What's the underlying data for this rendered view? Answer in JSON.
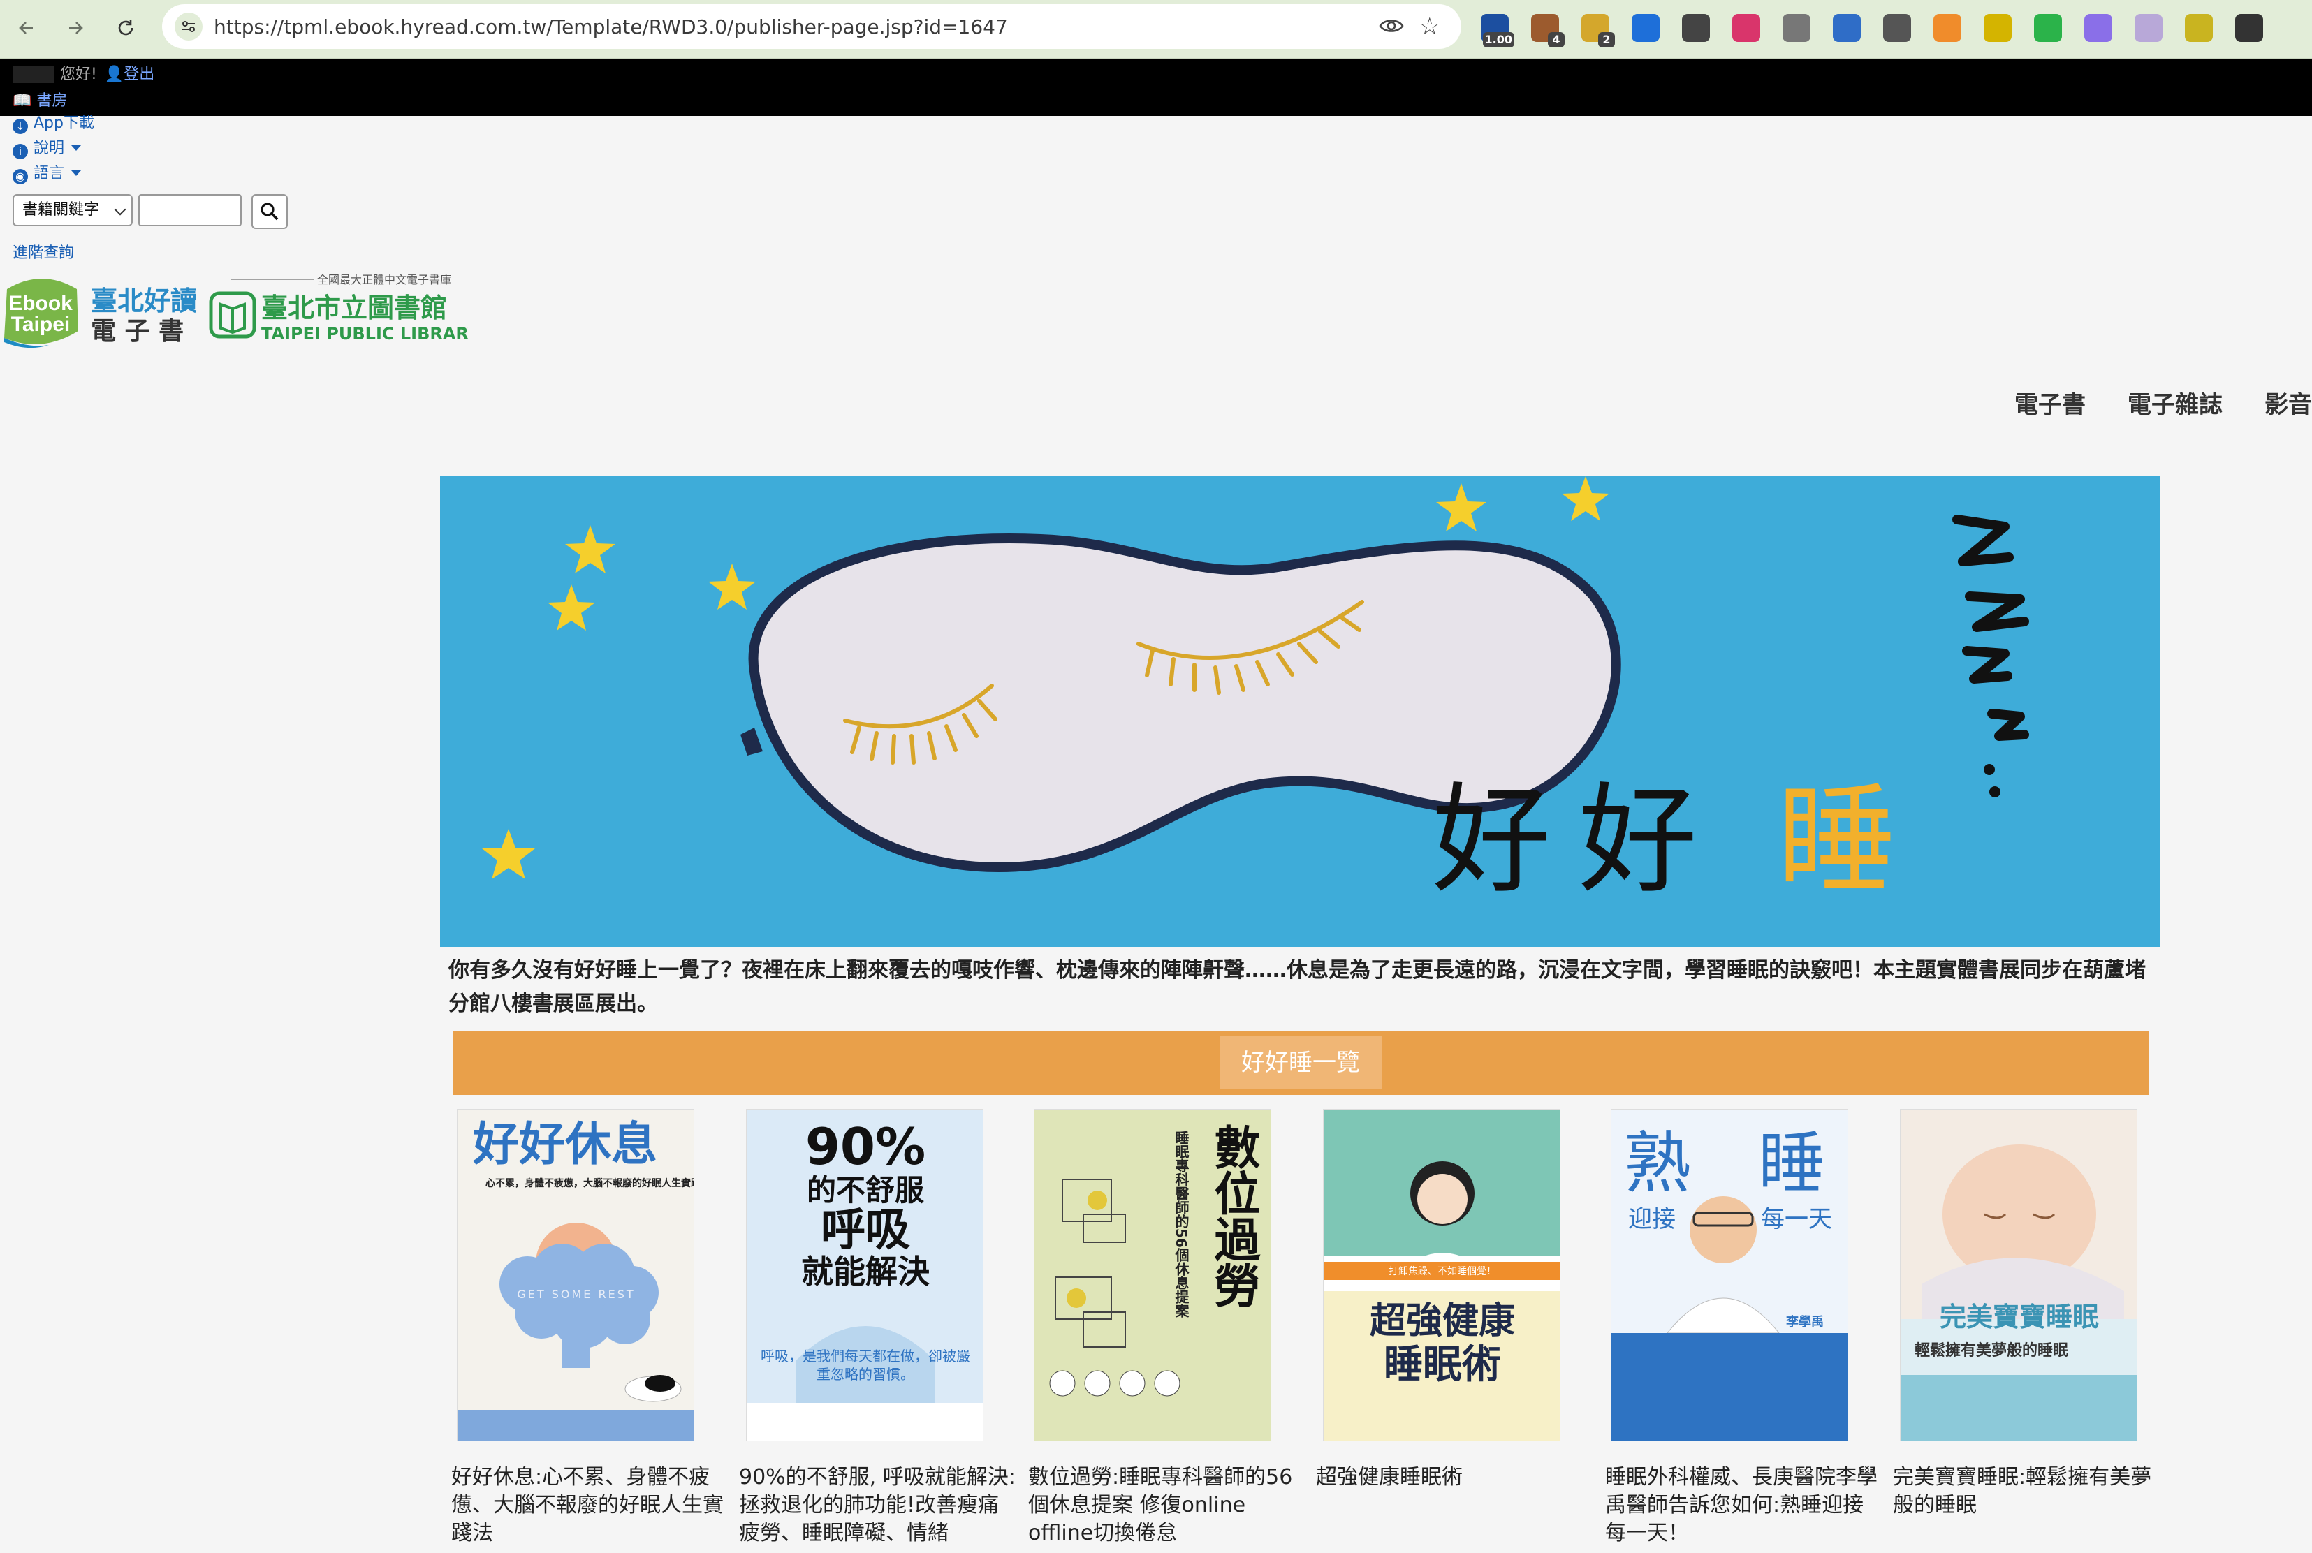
{
  "browser": {
    "url": "https://tpml.ebook.hyread.com.tw/Template/RWD3.0/publisher-page.jsp?id=1647",
    "extensions": [
      {
        "icon": "video-speed-icon",
        "badge": "1.00",
        "color": "#1c4fa0"
      },
      {
        "icon": "cookie-icon",
        "badge": "4",
        "color": "#9c5b2e"
      },
      {
        "icon": "tab-folder-icon",
        "badge": "2",
        "color": "#d4a72c"
      },
      {
        "icon": "download-icon",
        "badge": "",
        "color": "#1e6fd9"
      },
      {
        "icon": "markdown-icon",
        "badge": "",
        "color": "#444444"
      },
      {
        "icon": "translate-icon",
        "badge": "",
        "color": "#d9356b"
      },
      {
        "icon": "layers-icon",
        "badge": "",
        "color": "#777777"
      },
      {
        "icon": "document-icon",
        "badge": "",
        "color": "#2f6dc7"
      },
      {
        "icon": "copy-icon",
        "badge": "",
        "color": "#555555"
      },
      {
        "icon": "search-q-icon",
        "badge": "",
        "color": "#f08c2b"
      },
      {
        "icon": "n-extension-icon",
        "badge": "",
        "color": "#d4b400"
      },
      {
        "icon": "grammar-icon",
        "badge": "",
        "color": "#2bb34a"
      },
      {
        "icon": "wizard-icon",
        "badge": "",
        "color": "#8a6fe8"
      },
      {
        "icon": "shield-icon",
        "badge": "",
        "color": "#b8a8d8"
      },
      {
        "icon": "tray-icon",
        "badge": "",
        "color": "#c9b420"
      },
      {
        "icon": "puzzle-icon",
        "badge": "",
        "color": "#333333"
      }
    ]
  },
  "topbar": {
    "greeting": "您好!",
    "logout": "登出",
    "bookshelf": "書房"
  },
  "utility": {
    "app_download": "App下載",
    "help": "說明",
    "language": "語言"
  },
  "search": {
    "select_value": "書籍關鍵字",
    "input_value": "",
    "advanced": "進階查詢"
  },
  "logos": {
    "ebook_line1": "Ebook",
    "ebook_line2": "Taipei",
    "tagline": "全國最大正體中文電子書庫",
    "name1_top": "臺北好讀",
    "name1_bottom": "電 子 書",
    "name2_top": "臺北市立圖書館",
    "name2_bottom": "TAIPEI PUBLIC LIBRARY"
  },
  "topnav": [
    "電子書",
    "電子雜誌",
    "影音"
  ],
  "banner": {
    "text_part1": "好好",
    "text_part2": "睡"
  },
  "description": "你有多久沒有好好睡上一覺了？夜裡在床上翻來覆去的嘎吱作響、枕邊傳來的陣陣鼾聲……休息是為了走更長遠的路，沉浸在文字間，學習睡眠的訣竅吧！本主題實體書展同步在葫蘆堵分館八樓書展區展出。",
  "section_title": "好好睡一覽",
  "books": [
    {
      "title": "好好休息:心不累、身體不疲憊、大腦不報廢的好眠人生實踐法",
      "cover_title": "好好休息",
      "cover_sub": "心不累，身體不疲憊，大腦不報廢的好眠人生實踐法",
      "cover_en": "GET SOME REST"
    },
    {
      "title": "90%的不舒服, 呼吸就能解決:拯救退化的肺功能!改善瘦痛疲勞、睡眠障礙、情緒",
      "cover_title_1": "90%",
      "cover_title_2": "的不舒服",
      "cover_title_3": "呼吸",
      "cover_title_4": "就能解決",
      "cover_sub": "呼吸，是我們每天都在做，卻被嚴重忽略的習慣。"
    },
    {
      "title": "數位過勞:睡眠專科醫師的56個休息提案 修復online offline切換倦怠",
      "cover_title": "數位過勞",
      "cover_sub": "睡眠專科醫師的56個休息提案"
    },
    {
      "title": "超強健康睡眠術",
      "cover_title_1": "超強健康",
      "cover_title_2": "睡眠術",
      "cover_sub": "打卸焦躁、不如睡個覺！"
    },
    {
      "title": "睡眠外科權威、長庚醫院李學禹醫師告訴您如何:熟睡迎接每一天！",
      "cover_title_1": "熟",
      "cover_title_2": "睡",
      "cover_sub_1": "迎接",
      "cover_sub_2": "每一天",
      "cover_author": "李學禹"
    },
    {
      "title": "完美寶寶睡眠:輕鬆擁有美夢般的睡眠",
      "cover_title": "完美寶寶睡眠",
      "cover_sub": "輕鬆擁有美夢般的睡眠"
    }
  ],
  "colors": {
    "accent_orange": "#e9a04a",
    "banner_blue": "#3eacd9",
    "link_blue": "#1a5fb4"
  }
}
